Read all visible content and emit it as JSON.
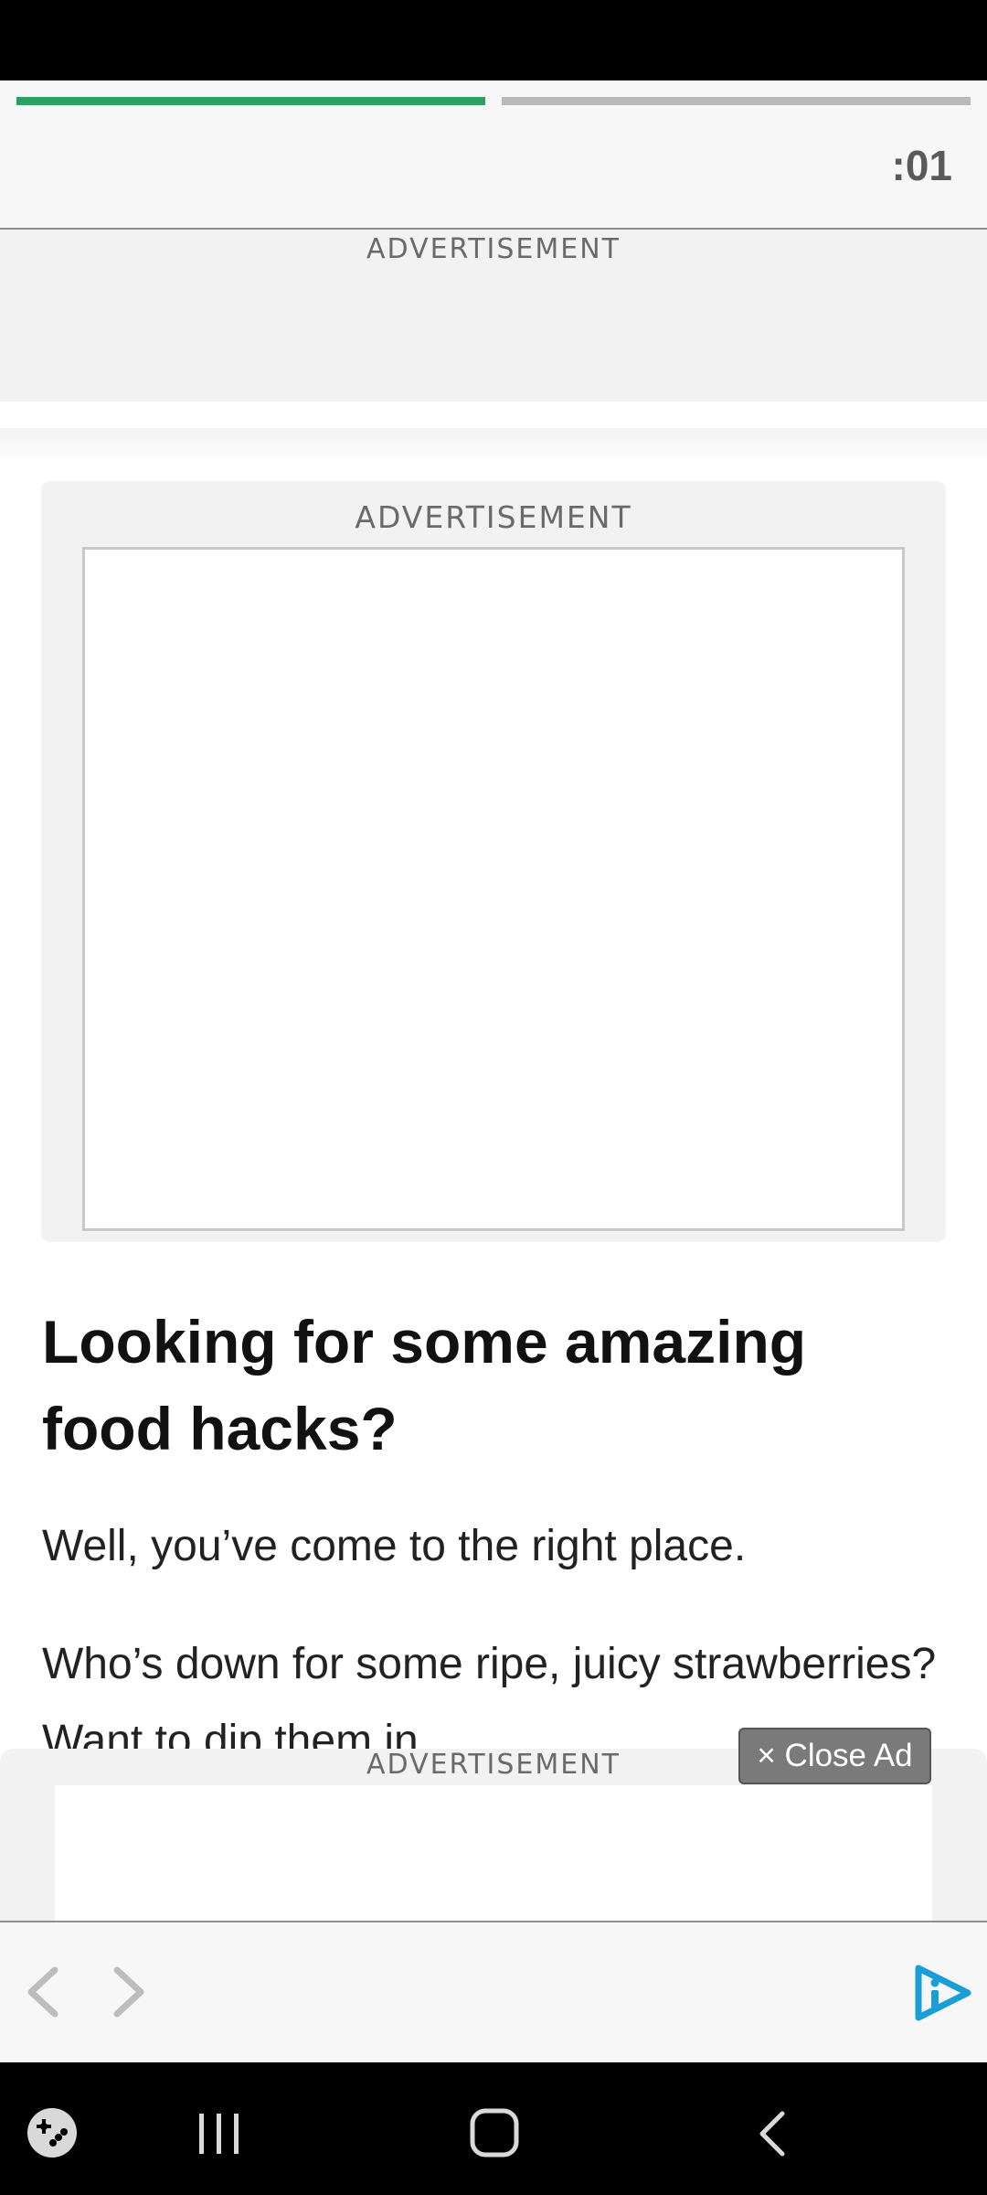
{
  "header": {
    "timer": ":01",
    "progress_filled_segments": 1,
    "progress_total_segments": 2,
    "accent_color": "#2f9e5f"
  },
  "top_ad": {
    "label": "ADVERTISEMENT"
  },
  "mid_ad": {
    "label": "ADVERTISEMENT"
  },
  "article": {
    "headline": "Looking for some amazing food hacks?",
    "paragraph_1": "Well, you’ve come to the right place.",
    "paragraph_2": "Who’s down for some ripe, juicy strawberries? Want to dip them in"
  },
  "bottom_ad": {
    "label": "ADVERTISEMENT",
    "close_label": "× Close Ad"
  },
  "nav": {
    "back_icon": "chevron-left-icon",
    "forward_icon": "chevron-right-icon",
    "brand_icon": "play-brand-icon",
    "brand_color": "#1a9ed6"
  },
  "system_nav": {
    "game_icon": "game-launcher-icon",
    "recents_icon": "recents-icon",
    "home_icon": "home-icon",
    "back_icon": "back-icon"
  }
}
